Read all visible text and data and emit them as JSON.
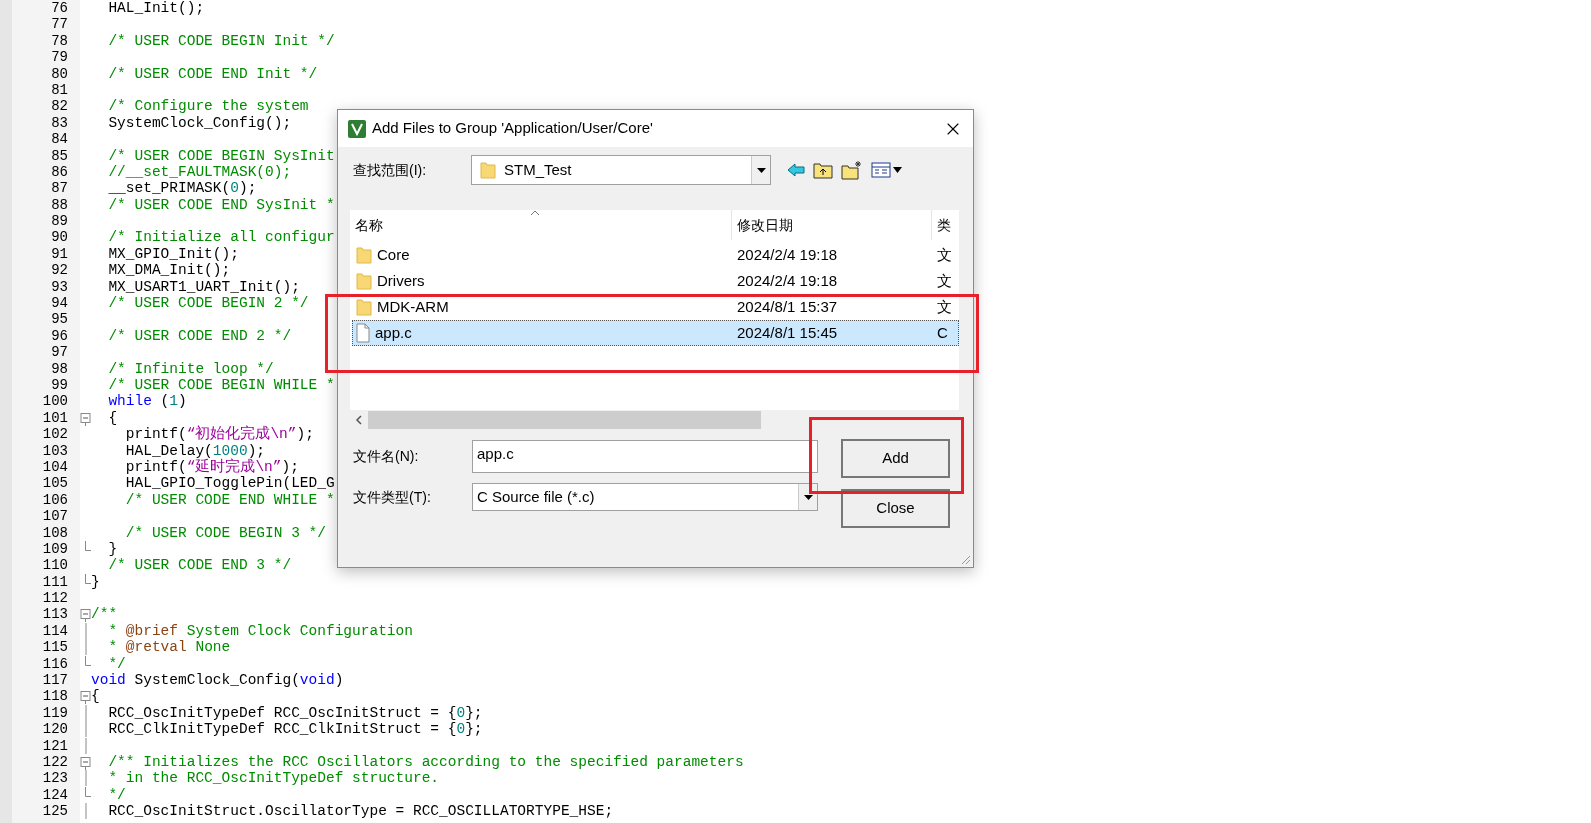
{
  "code_editor": {
    "lines": [
      {
        "kind": "code",
        "number": "76",
        "segments": [
          {
            "kind": "plain",
            "text": "  HAL_Init();"
          }
        ]
      },
      {
        "kind": "code",
        "number": "77"
      },
      {
        "kind": "code",
        "number": "78",
        "segments": [
          {
            "kind": "comment",
            "text": "  /* USER CODE BEGIN Init */"
          }
        ]
      },
      {
        "kind": "code",
        "number": "79"
      },
      {
        "kind": "code",
        "number": "80",
        "segments": [
          {
            "kind": "comment",
            "text": "  /* USER CODE END Init */"
          }
        ]
      },
      {
        "kind": "code",
        "number": "81"
      },
      {
        "kind": "code",
        "number": "82",
        "segments": [
          {
            "kind": "comment",
            "text": "  /* Configure the system"
          }
        ]
      },
      {
        "kind": "code",
        "number": "83",
        "segments": [
          {
            "kind": "plain",
            "text": "  SystemClock_Config();"
          }
        ]
      },
      {
        "kind": "code",
        "number": "84"
      },
      {
        "kind": "code",
        "number": "85",
        "segments": [
          {
            "kind": "comment",
            "text": "  /* USER CODE BEGIN SysInit"
          }
        ]
      },
      {
        "kind": "code",
        "number": "86",
        "segments": [
          {
            "kind": "comment",
            "text": "  //__set_FAULTMASK(0);"
          }
        ]
      },
      {
        "kind": "code",
        "number": "87",
        "segments": [
          {
            "kind": "plain",
            "text": "  __set_PRIMASK("
          },
          {
            "kind": "number",
            "text": "0"
          },
          {
            "kind": "plain",
            "text": ");"
          }
        ]
      },
      {
        "kind": "code",
        "number": "88",
        "segments": [
          {
            "kind": "comment",
            "text": "  /* USER CODE END SysInit *"
          }
        ]
      },
      {
        "kind": "code",
        "number": "89"
      },
      {
        "kind": "code",
        "number": "90",
        "segments": [
          {
            "kind": "comment",
            "text": "  /* Initialize all configur"
          }
        ]
      },
      {
        "kind": "code",
        "number": "91",
        "segments": [
          {
            "kind": "plain",
            "text": "  MX_GPIO_Init();"
          }
        ]
      },
      {
        "kind": "code",
        "number": "92",
        "segments": [
          {
            "kind": "plain",
            "text": "  MX_DMA_Init();"
          }
        ]
      },
      {
        "kind": "code",
        "number": "93",
        "segments": [
          {
            "kind": "plain",
            "text": "  MX_USART1_UART_Init();"
          }
        ]
      },
      {
        "kind": "code",
        "number": "94",
        "segments": [
          {
            "kind": "comment",
            "text": "  /* USER CODE BEGIN 2 */"
          }
        ]
      },
      {
        "kind": "code",
        "number": "95"
      },
      {
        "kind": "code",
        "number": "96",
        "segments": [
          {
            "kind": "comment",
            "text": "  /* USER CODE END 2 */"
          }
        ]
      },
      {
        "kind": "code",
        "number": "97"
      },
      {
        "kind": "code",
        "number": "98",
        "segments": [
          {
            "kind": "comment",
            "text": "  /* Infinite loop */"
          }
        ]
      },
      {
        "kind": "code",
        "number": "99",
        "segments": [
          {
            "kind": "comment",
            "text": "  /* USER CODE BEGIN WHILE *"
          }
        ]
      },
      {
        "kind": "code",
        "number": "100",
        "segments": [
          {
            "kind": "keyword",
            "text": "  while"
          },
          {
            "kind": "plain",
            "text": " ("
          },
          {
            "kind": "number",
            "text": "1"
          },
          {
            "kind": "plain",
            "text": ")"
          }
        ]
      },
      {
        "kind": "fold_start",
        "number": "101",
        "segments": [
          {
            "kind": "plain",
            "text": "  {"
          }
        ]
      },
      {
        "kind": "code",
        "number": "102",
        "segments": [
          {
            "kind": "plain",
            "text": "    printf("
          },
          {
            "kind": "string",
            "text": "“初始化完成\\n”"
          },
          {
            "kind": "plain",
            "text": ");"
          }
        ]
      },
      {
        "kind": "code",
        "number": "103",
        "segments": [
          {
            "kind": "plain",
            "text": "    HAL_Delay("
          },
          {
            "kind": "number",
            "text": "1000"
          },
          {
            "kind": "plain",
            "text": ");"
          }
        ]
      },
      {
        "kind": "code",
        "number": "104",
        "segments": [
          {
            "kind": "plain",
            "text": "    printf("
          },
          {
            "kind": "string",
            "text": "“延时完成\\n”"
          },
          {
            "kind": "plain",
            "text": ");"
          }
        ]
      },
      {
        "kind": "code",
        "number": "105",
        "segments": [
          {
            "kind": "plain",
            "text": "    HAL_GPIO_TogglePin(LED_G"
          }
        ]
      },
      {
        "kind": "code",
        "number": "106",
        "segments": [
          {
            "kind": "comment",
            "text": "    /* USER CODE END WHILE *"
          }
        ]
      },
      {
        "kind": "code",
        "number": "107"
      },
      {
        "kind": "code",
        "number": "108",
        "segments": [
          {
            "kind": "comment",
            "text": "    /* USER CODE BEGIN 3 */"
          }
        ]
      },
      {
        "kind": "fold_end",
        "number": "109",
        "segments": [
          {
            "kind": "plain",
            "text": "  }"
          }
        ]
      },
      {
        "kind": "code",
        "number": "110",
        "segments": [
          {
            "kind": "comment",
            "text": "  /* USER CODE END 3 */"
          }
        ]
      },
      {
        "kind": "fold_end",
        "number": "111",
        "segments": [
          {
            "kind": "plain",
            "text": "}"
          }
        ]
      },
      {
        "kind": "code",
        "number": "112"
      },
      {
        "kind": "fold_start",
        "number": "113",
        "segments": [
          {
            "kind": "comment",
            "text": "/**"
          }
        ]
      },
      {
        "kind": "fold_line",
        "number": "114",
        "segments": [
          {
            "kind": "comment",
            "text": "  * "
          },
          {
            "kind": "doc_tag",
            "text": "@brief"
          },
          {
            "kind": "comment",
            "text": " System Clock Configuration"
          }
        ]
      },
      {
        "kind": "fold_line",
        "number": "115",
        "segments": [
          {
            "kind": "comment",
            "text": "  * "
          },
          {
            "kind": "doc_tag",
            "text": "@retval"
          },
          {
            "kind": "comment",
            "text": " None"
          }
        ]
      },
      {
        "kind": "fold_end",
        "number": "116",
        "segments": [
          {
            "kind": "comment",
            "text": "  */"
          }
        ]
      },
      {
        "kind": "code",
        "number": "117",
        "segments": [
          {
            "kind": "keyword",
            "text": "void"
          },
          {
            "kind": "plain",
            "text": " SystemClock_Config("
          },
          {
            "kind": "keyword",
            "text": "void"
          },
          {
            "kind": "plain",
            "text": ")"
          }
        ]
      },
      {
        "kind": "fold_start",
        "number": "118",
        "segments": [
          {
            "kind": "plain",
            "text": "{"
          }
        ]
      },
      {
        "kind": "fold_line",
        "number": "119",
        "segments": [
          {
            "kind": "plain",
            "text": "  RCC_OscInitTypeDef RCC_OscInitStruct = {"
          },
          {
            "kind": "number",
            "text": "0"
          },
          {
            "kind": "plain",
            "text": "};"
          }
        ]
      },
      {
        "kind": "fold_line",
        "number": "120",
        "segments": [
          {
            "kind": "plain",
            "text": "  RCC_ClkInitTypeDef RCC_ClkInitStruct = {"
          },
          {
            "kind": "number",
            "text": "0"
          },
          {
            "kind": "plain",
            "text": "};"
          }
        ]
      },
      {
        "kind": "fold_line",
        "number": "121"
      },
      {
        "kind": "fold_start",
        "number": "122",
        "segments": [
          {
            "kind": "comment",
            "text": "  /** Initializes the RCC Oscillators according to the specified parameters"
          }
        ]
      },
      {
        "kind": "fold_line",
        "number": "123",
        "segments": [
          {
            "kind": "comment",
            "text": "  * in the RCC_OscInitTypeDef structure."
          }
        ]
      },
      {
        "kind": "fold_end",
        "number": "124",
        "segments": [
          {
            "kind": "comment",
            "text": "  */"
          }
        ]
      },
      {
        "kind": "fold_line",
        "number": "125",
        "segments": [
          {
            "kind": "plain",
            "text": "  RCC_OscInitStruct.OscillatorType = RCC_OSCILLATORTYPE_HSE;"
          }
        ]
      }
    ]
  },
  "dialog": {
    "title": "Add Files to Group 'Application/User/Core'",
    "look_in": {
      "label": "查找范围(I):",
      "value": "STM_Test"
    },
    "file_list": {
      "columns": [
        "名称",
        "修改日期",
        "类"
      ],
      "rows": [
        {
          "kind": "folder",
          "name": "Core",
          "modified": "2024/2/4 19:18",
          "type": "文",
          "selected": false
        },
        {
          "kind": "folder",
          "name": "Drivers",
          "modified": "2024/2/4 19:18",
          "type": "文",
          "selected": false
        },
        {
          "kind": "folder",
          "name": "MDK-ARM",
          "modified": "2024/8/1 15:37",
          "type": "文",
          "selected": false
        },
        {
          "kind": "file",
          "name": "app.c",
          "modified": "2024/8/1 15:45",
          "type": "C",
          "selected": true
        }
      ]
    },
    "file_name": {
      "label": "文件名(N):",
      "value": "app.c"
    },
    "file_type": {
      "label": "文件类型(T):",
      "value": "C Source file (*.c)"
    },
    "buttons": [
      {
        "label": "Add"
      },
      {
        "label": "Close"
      }
    ]
  }
}
